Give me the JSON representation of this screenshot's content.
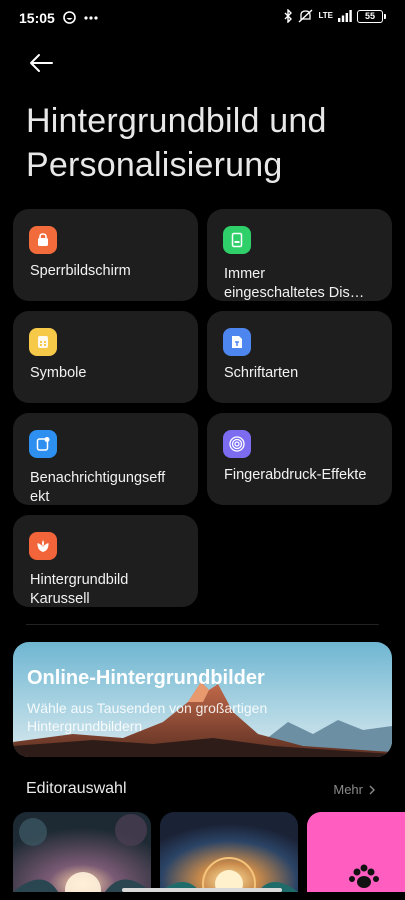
{
  "status_bar": {
    "time": "15:05",
    "network": "LTE",
    "battery": "55"
  },
  "page": {
    "title": "Hintergrundbild und Personalisierung"
  },
  "tiles": [
    {
      "label": "Sperrbildschirm",
      "icon": "lock-screen-icon",
      "color": "#f26b3a"
    },
    {
      "label": "Immer eingeschaltetes Dis…",
      "icon": "always-on-display-icon",
      "color": "#2fcf6a"
    },
    {
      "label": "Symbole",
      "icon": "icons-icon",
      "color": "#f7c948"
    },
    {
      "label": "Schriftarten",
      "icon": "fonts-icon",
      "color": "#4e86f0"
    },
    {
      "label": "Benachrichtigungseffekt",
      "icon": "notification-effect-icon",
      "color": "#2d8ff0"
    },
    {
      "label": "Fingerabdruck-Effekte",
      "icon": "fingerprint-icon",
      "color": "#7b6cf0"
    },
    {
      "label": "Hintergrundbild Karussell",
      "icon": "wallpaper-carousel-icon",
      "color": "#f2643a"
    }
  ],
  "banner": {
    "title": "Online-Hintergrundbilder",
    "subtitle": "Wähle aus Tausenden von großartigen Hintergrundbildern"
  },
  "editors_choice": {
    "title": "Editorauswahl",
    "more_label": "Mehr"
  }
}
